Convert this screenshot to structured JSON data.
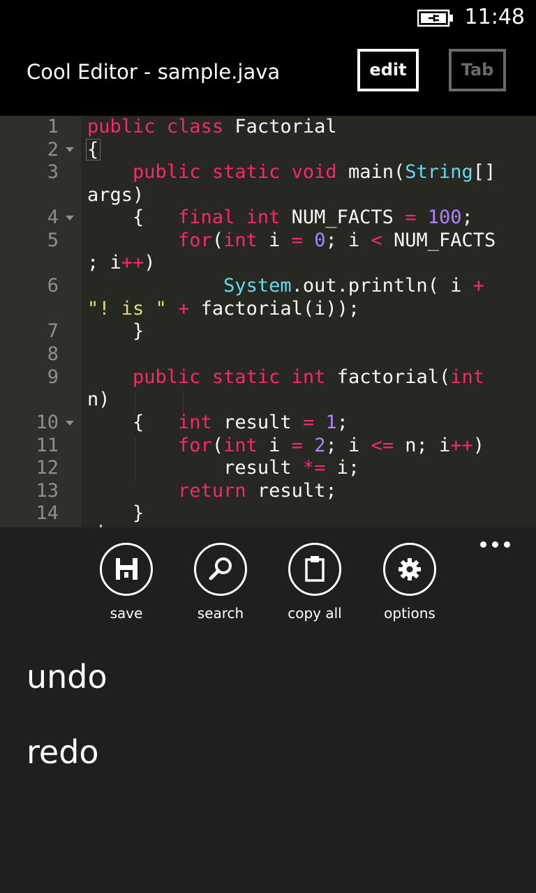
{
  "status_bar": {
    "time": "11:48",
    "battery_icon": "battery-charging-icon"
  },
  "header": {
    "title": "Cool Editor - sample.java",
    "edit_label": "edit",
    "tab_label": "Tab"
  },
  "editor": {
    "line_numbers": [
      "1",
      "2",
      "3",
      "4",
      "5",
      "6",
      "7",
      "8",
      "9",
      "10",
      "11",
      "12",
      "13",
      "14"
    ],
    "folded_lines": [
      "2",
      "4",
      "10"
    ],
    "code_lines": [
      "public class Factorial",
      "{",
      "    public static void main(String[]",
      "args)",
      "    {   final int NUM_FACTS = 100;",
      "        for(int i = 0; i < NUM_FACTS",
      "; i++)",
      "            System.out.println( i +",
      "\"! is \" + factorial(i));",
      "    }",
      "",
      "    public static int factorial(int",
      "n)",
      "    {   int result = 1;",
      "        for(int i = 2; i <= n; i++)",
      "            result *= i;",
      "        return result;",
      "    }"
    ],
    "colors": {
      "background": "#272822",
      "keyword": "#f92672",
      "type": "#66d9ef",
      "number": "#ae81ff",
      "string": "#e6db74"
    }
  },
  "app_bar": {
    "buttons": [
      {
        "label": "save",
        "icon": "save-icon"
      },
      {
        "label": "search",
        "icon": "search-icon"
      },
      {
        "label": "copy all",
        "icon": "clipboard-icon"
      },
      {
        "label": "options",
        "icon": "gear-icon"
      }
    ],
    "menu_items": [
      "undo",
      "redo"
    ],
    "more_icon": "more-icon"
  }
}
